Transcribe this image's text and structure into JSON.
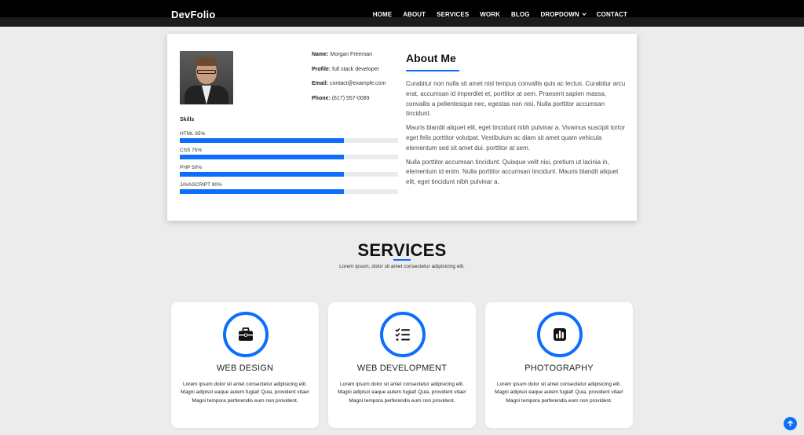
{
  "header": {
    "brand": "DevFolio",
    "nav": [
      {
        "label": "HOME"
      },
      {
        "label": "ABOUT"
      },
      {
        "label": "SERVICES"
      },
      {
        "label": "WORK"
      },
      {
        "label": "BLOG"
      },
      {
        "label": "DROPDOWN"
      },
      {
        "label": "CONTACT"
      }
    ]
  },
  "about": {
    "info": {
      "name_label": "Name:",
      "name": "Morgan Freeman",
      "profile_label": "Profile:",
      "profile": "full stack developer",
      "email_label": "Email:",
      "email": "contact@example.com",
      "phone_label": "Phone:",
      "phone": "(617) 557-0089"
    },
    "skills_title": "Skills",
    "skills": [
      {
        "label": "HTML 85%",
        "value": 0.75
      },
      {
        "label": "CSS 75%",
        "value": 0.75
      },
      {
        "label": "PHP 50%",
        "value": 0.75
      },
      {
        "label": "JAVASCRIPT 90%",
        "value": 0.75
      }
    ],
    "title": "About Me",
    "paragraphs": [
      "Curabitur non nulla sit amet nisl tempus convallis quis ac lectus. Curabitur arcu erat, accumsan id imperdiet et, porttitor at sem. Praesent sapien massa, convallis a pellentesque nec, egestas non nisi. Nulla porttitor accumsan tincidunt.",
      "Mauris blandit aliquet elit, eget tincidunt nibh pulvinar a. Vivamus suscipit tortor eget felis porttitor volutpat. Vestibulum ac diam sit amet quam vehicula elementum sed sit amet dui. porttitor at sem.",
      "Nulla porttitor accumsan tincidunt. Quisque velit nisi, pretium ut lacinia in, elementum id enim. Nulla porttitor accumsan tincidunt. Mauris blandit aliquet elit, eget tincidunt nibh pulvinar a."
    ]
  },
  "services": {
    "title": "SERVICES",
    "subtitle": "Lorem ipsum, dolor sit amet consectetur adipisicing elit.",
    "items": [
      {
        "title": "WEB DESIGN",
        "icon": "briefcase-icon",
        "desc": "Lorem ipsum dolor sit amet consectetur adipisicing elit. Magni adipisci eaque autem fugiat! Quia, provident vitae! Magni tempora perferendis eum non provident."
      },
      {
        "title": "WEB DEVELOPMENT",
        "icon": "checklist-icon",
        "desc": "Lorem ipsum dolor sit amet consectetur adipisicing elit. Magni adipisci eaque autem fugiat! Quia, provident vitae! Magni tempora perferendis eum non provident."
      },
      {
        "title": "PHOTOGRAPHY",
        "icon": "bar-chart-icon",
        "desc": "Lorem ipsum dolor sit amet consectetur adipisicing elit. Magni adipisci eaque autem fugiat! Quia, provident vitae! Magni tempora perferendis eum non provident."
      }
    ]
  },
  "colors": {
    "accent": "#0d6efd",
    "header": "#000000",
    "background": "#ececec"
  }
}
